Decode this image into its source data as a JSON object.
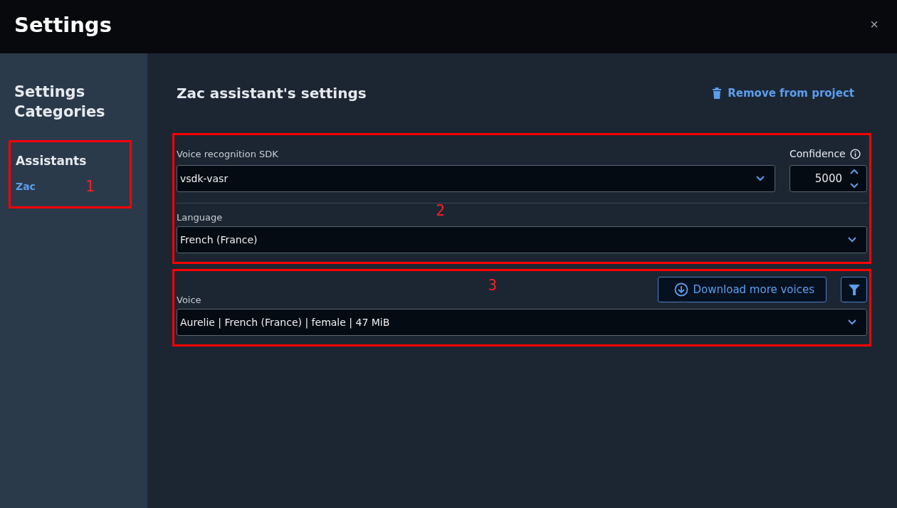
{
  "window": {
    "title": "Settings",
    "close": "×"
  },
  "sidebar": {
    "heading": "Settings Categories",
    "annotation": "1",
    "group": "Assistants",
    "items": [
      {
        "label": "Zac",
        "selected": true
      }
    ]
  },
  "main": {
    "title": "Zac assistant's settings",
    "remove_button": "Remove from project",
    "recognition": {
      "annotation": "2",
      "sdk": {
        "label": "Voice recognition SDK",
        "value": "vsdk-vasr"
      },
      "confidence": {
        "label": "Confidence",
        "value": "5000"
      },
      "language": {
        "label": "Language",
        "value": "French (France)"
      }
    },
    "voice": {
      "annotation": "3",
      "label": "Voice",
      "value": "Aurelie | French (France) | female | 47 MiB",
      "download_button": "Download more voices"
    }
  }
}
